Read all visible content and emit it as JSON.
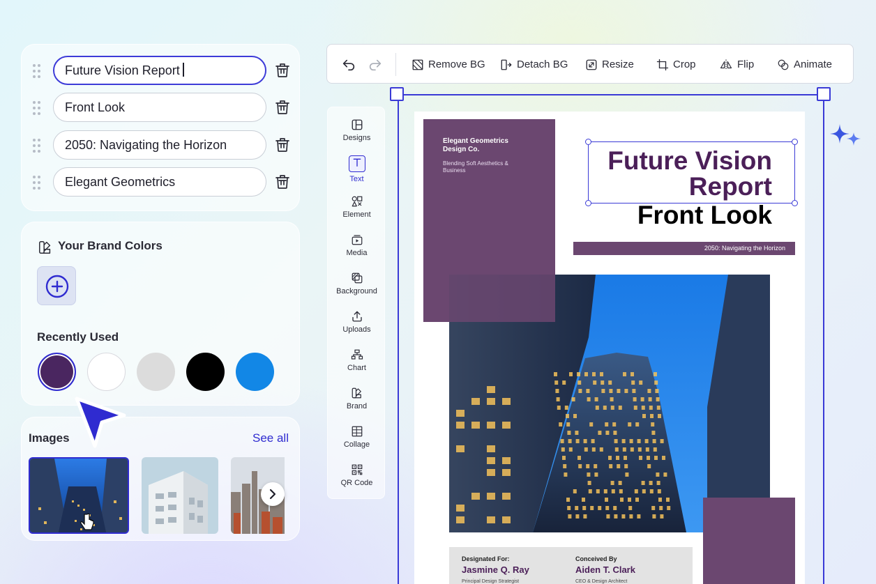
{
  "text_items": [
    {
      "value": "Future Vision Report",
      "active": true
    },
    {
      "value": "Front Look",
      "active": false
    },
    {
      "value": "2050: Navigating the Horizon",
      "active": false
    },
    {
      "value": "Elegant Geometrics",
      "active": false
    }
  ],
  "brand": {
    "title": "Your Brand Colors",
    "recent_title": "Recently Used",
    "recent_colors": [
      "#4a2660",
      "#ffffff",
      "#dcdcdc",
      "#000000",
      "#1287e6"
    ]
  },
  "images": {
    "title": "Images",
    "see_all": "See all"
  },
  "toolbar": {
    "remove_bg": "Remove BG",
    "detach_bg": "Detach BG",
    "resize": "Resize",
    "crop": "Crop",
    "flip": "Flip",
    "animate": "Animate"
  },
  "side_nav": [
    {
      "label": "Designs",
      "icon": "layout-icon"
    },
    {
      "label": "Text",
      "icon": "text-icon",
      "active": true
    },
    {
      "label": "Element",
      "icon": "shapes-icon"
    },
    {
      "label": "Media",
      "icon": "media-icon"
    },
    {
      "label": "Background",
      "icon": "background-icon"
    },
    {
      "label": "Uploads",
      "icon": "upload-icon"
    },
    {
      "label": "Chart",
      "icon": "chart-icon"
    },
    {
      "label": "Brand",
      "icon": "brand-icon"
    },
    {
      "label": "Collage",
      "icon": "collage-icon"
    },
    {
      "label": "QR Code",
      "icon": "qr-code-icon"
    }
  ],
  "document": {
    "company": "Elegant Geometrics\nDesign Co.",
    "tagline": "Blending Soft Aesthetics &\nBusiness",
    "title_line1": "Future Vision",
    "title_line2": "Report",
    "subtitle": "Front Look",
    "banner": "2050: Navigating the Horizon",
    "designed_for_label": "Designated For:",
    "designed_for_name": "Jasmine Q. Ray",
    "designed_for_role": "Principal Design Strategist",
    "conceived_by_label": "Conceived By",
    "conceived_by_name": "Aiden T. Clark",
    "conceived_by_role": "CEO & Design Architect"
  },
  "colors": {
    "accent": "#3a3ad6",
    "doc_purple": "#6b4770",
    "title_purple": "#4b1f58"
  }
}
